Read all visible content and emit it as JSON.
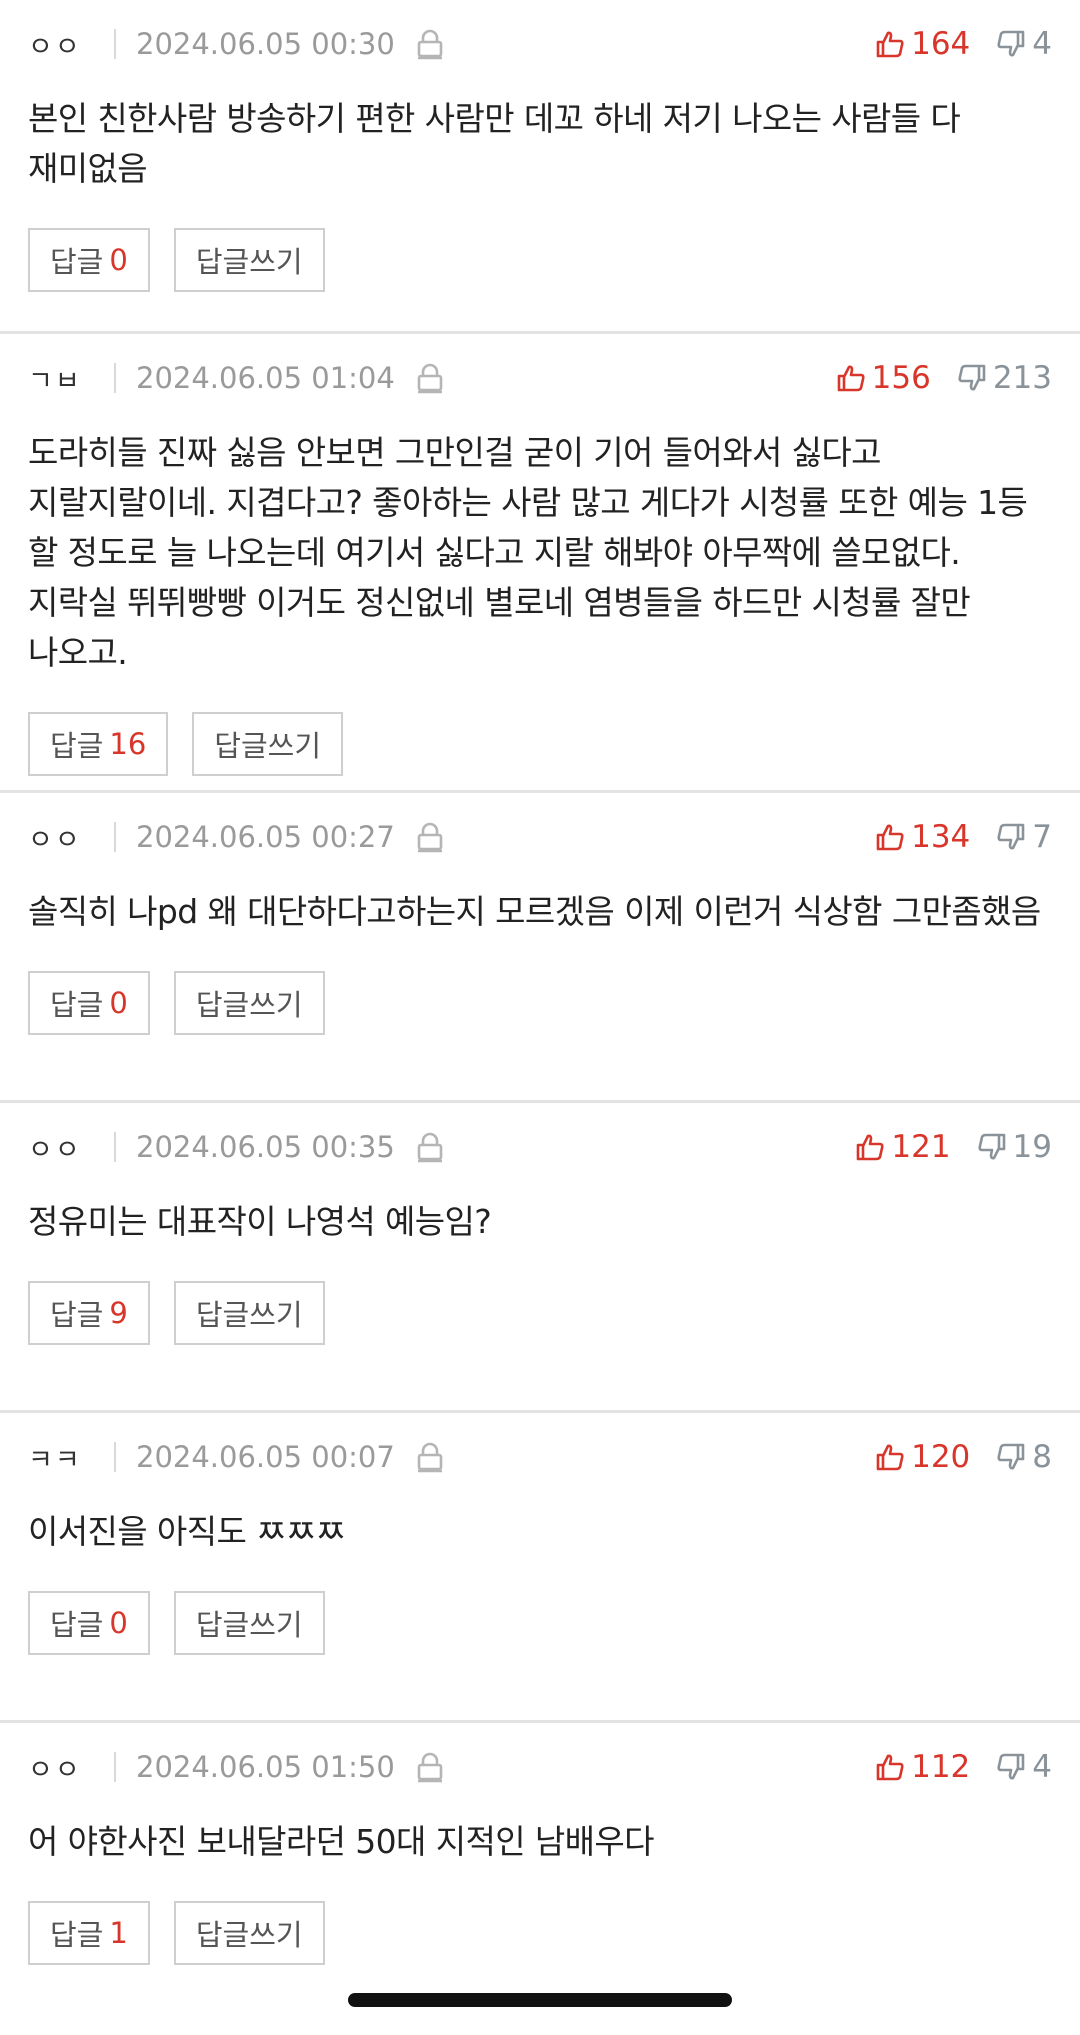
{
  "comments": [
    {
      "author": "ㅇㅇ",
      "date": "2024.06.05 00:30",
      "likes": "164",
      "dislikes": "4",
      "text": "본인 친한사람 방송하기 편한 사람만 데꼬 하네 저기 나오는 사람들 다 재미없음",
      "reply_label": "답글",
      "reply_count": "0",
      "write_reply_label": "답글쓰기"
    },
    {
      "author": "ㄱㅂ",
      "date": "2024.06.05 01:04",
      "likes": "156",
      "dislikes": "213",
      "text": "도라히들 진짜 싫음 안보면 그만인걸 굳이 기어 들어와서 싫다고 지랄지랄이네. 지겹다고? 좋아하는 사람 많고 게다가 시청률 또한 예능 1등 할 정도로 늘 나오는데 여기서 싫다고 지랄 해봐야 아무짝에 쓸모없다. 지락실 뛰뛰빵빵 이거도 정신없네 별로네 염병들을 하드만 시청률 잘만 나오고.",
      "reply_label": "답글",
      "reply_count": "16",
      "write_reply_label": "답글쓰기"
    },
    {
      "author": "ㅇㅇ",
      "date": "2024.06.05 00:27",
      "likes": "134",
      "dislikes": "7",
      "text": "솔직히 나pd 왜 대단하다고하는지 모르겠음 이제 이런거 식상함 그만좀했음",
      "reply_label": "답글",
      "reply_count": "0",
      "write_reply_label": "답글쓰기"
    },
    {
      "author": "ㅇㅇ",
      "date": "2024.06.05 00:35",
      "likes": "121",
      "dislikes": "19",
      "text": "정유미는 대표작이 나영석 예능임?",
      "reply_label": "답글",
      "reply_count": "9",
      "write_reply_label": "답글쓰기"
    },
    {
      "author": "ㅋㅋ",
      "date": "2024.06.05 00:07",
      "likes": "120",
      "dislikes": "8",
      "text": "이서진을 아직도 ㅉㅉㅉ",
      "reply_label": "답글",
      "reply_count": "0",
      "write_reply_label": "답글쓰기"
    },
    {
      "author": "ㅇㅇ",
      "date": "2024.06.05 01:50",
      "likes": "112",
      "dislikes": "4",
      "text": "어 야한사진 보내달라던 50대 지적인 남배우다",
      "reply_label": "답글",
      "reply_count": "1",
      "write_reply_label": "답글쓰기"
    }
  ],
  "colors": {
    "accent": "#d8362a",
    "muted": "#9a9a9a",
    "dislike": "#8a939a",
    "divider": "#e3e3e3"
  },
  "icons": {
    "lock": "lock-icon",
    "like": "thumbs-up-icon",
    "dislike": "thumbs-down-icon"
  }
}
